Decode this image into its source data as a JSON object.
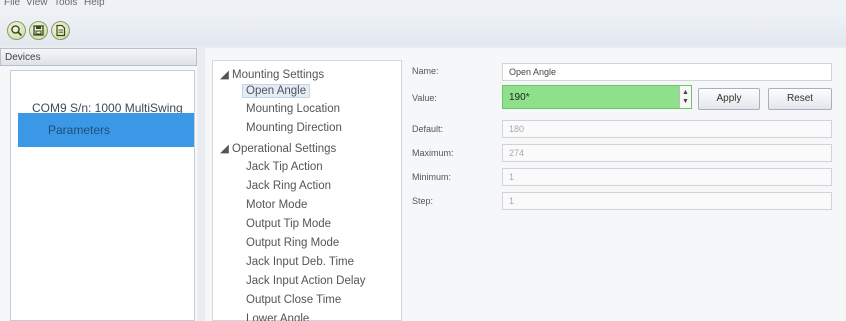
{
  "menu": [
    "File",
    "View",
    "Tools",
    "Help"
  ],
  "toolbar": {
    "buttons": [
      {
        "name": "search-icon"
      },
      {
        "name": "save-icon"
      },
      {
        "name": "document-icon"
      }
    ]
  },
  "devices": {
    "header": "Devices",
    "items": [
      {
        "label": "COM9 S/n: 1000 MultiSwing"
      },
      {
        "label": "Parameters",
        "selected": true
      }
    ]
  },
  "tree": {
    "groups": [
      {
        "label": "Mounting Settings",
        "children": [
          "Open Angle",
          "Mounting Location",
          "Mounting Direction"
        ]
      },
      {
        "label": "Operational Settings",
        "children": [
          "Jack Tip Action",
          "Jack Ring Action",
          "Motor Mode",
          "Output Tip Mode",
          "Output Ring Mode",
          "Jack Input Deb. Time",
          "Jack Input Action Delay",
          "Output Close Time",
          "Lower Angle"
        ]
      }
    ],
    "selected": "Open Angle"
  },
  "form": {
    "name_label": "Name:",
    "name_value": "Open Angle",
    "value_label": "Value:",
    "value_value": "190",
    "value_marker": "*",
    "apply_label": "Apply",
    "reset_label": "Reset",
    "default_label": "Default:",
    "default_value": "180",
    "maximum_label": "Maximum:",
    "maximum_value": "274",
    "minimum_label": "Minimum:",
    "minimum_value": "1",
    "step_label": "Step:",
    "step_value": "1"
  },
  "colors": {
    "selection": "#3b98e6",
    "value_highlight": "#8fe08a"
  }
}
